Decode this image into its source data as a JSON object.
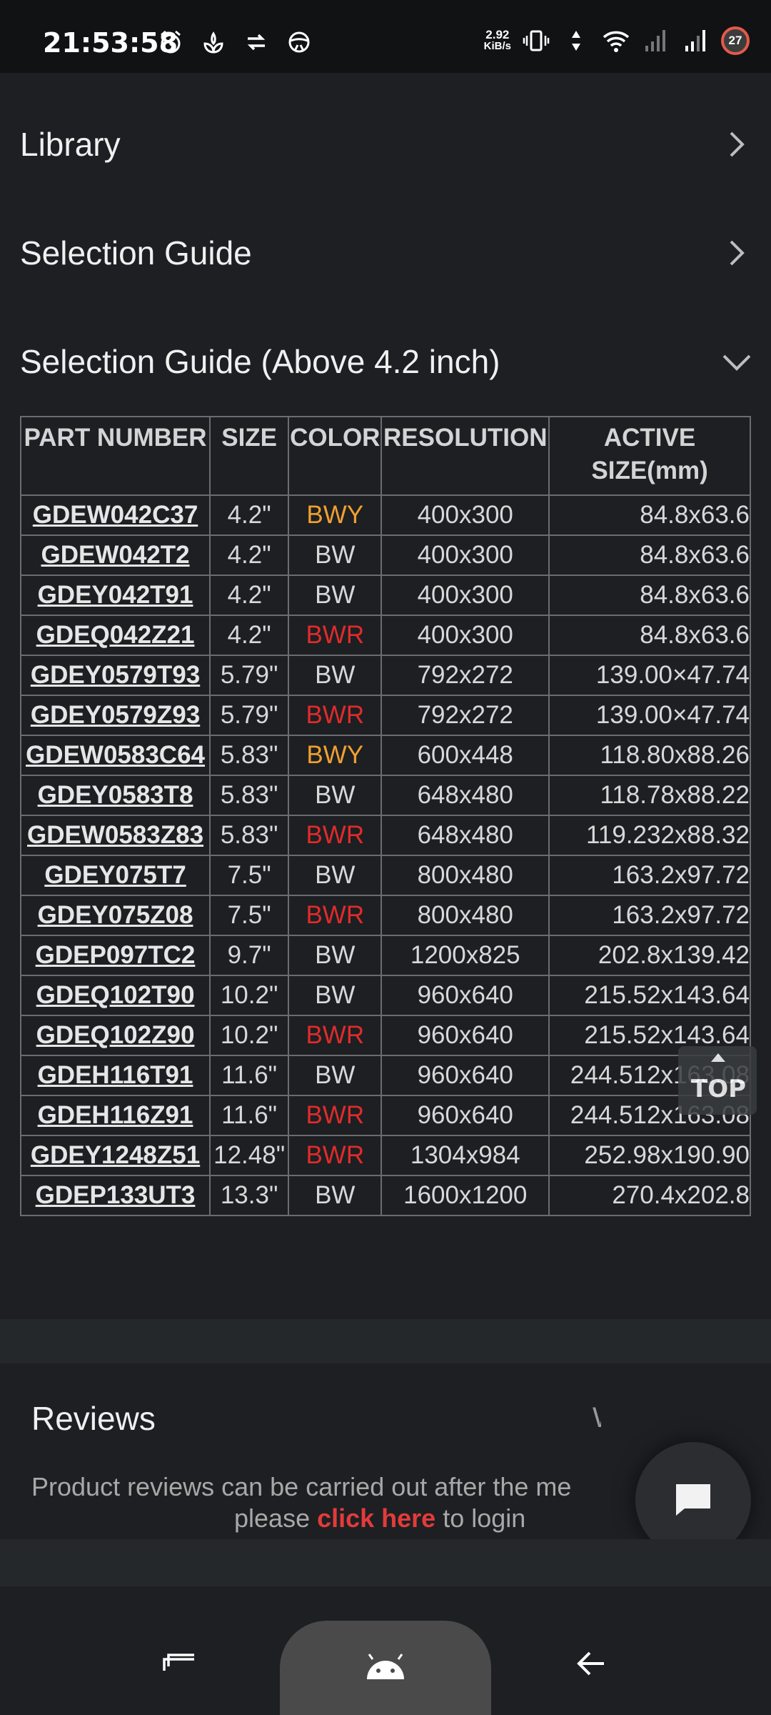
{
  "status": {
    "time": "21:53:58",
    "speed_value": "2.92",
    "speed_unit": "KiB/s",
    "battery": "27"
  },
  "menu": {
    "library": "Library",
    "selection_guide": "Selection Guide",
    "selection_guide_above": "Selection Guide (Above 4.2 inch)"
  },
  "table": {
    "headers": {
      "part": "PART NUMBER",
      "size": "SIZE",
      "color": "COLOR",
      "resolution": "RESOLUTION",
      "active_1": "ACTIVE",
      "active_2": "SIZE(mm)"
    },
    "rows": [
      {
        "part": "GDEW042C37",
        "size": "4.2\"",
        "color": "BWY",
        "resolution": "400x300",
        "active": "84.8x63.6"
      },
      {
        "part": "GDEW042T2",
        "size": "4.2\"",
        "color": "BW",
        "resolution": "400x300",
        "active": "84.8x63.6"
      },
      {
        "part": "GDEY042T91",
        "size": "4.2\"",
        "color": "BW",
        "resolution": "400x300",
        "active": "84.8x63.6"
      },
      {
        "part": "GDEQ042Z21",
        "size": "4.2\"",
        "color": "BWR",
        "resolution": "400x300",
        "active": "84.8x63.6"
      },
      {
        "part": "GDEY0579T93",
        "size": "5.79\"",
        "color": "BW",
        "resolution": "792x272",
        "active": "139.00×47.74"
      },
      {
        "part": "GDEY0579Z93",
        "size": "5.79\"",
        "color": "BWR",
        "resolution": "792x272",
        "active": "139.00×47.74"
      },
      {
        "part": "GDEW0583C64",
        "size": "5.83\"",
        "color": "BWY",
        "resolution": "600x448",
        "active": "118.80x88.26"
      },
      {
        "part": "GDEY0583T8",
        "size": "5.83\"",
        "color": "BW",
        "resolution": "648x480",
        "active": "118.78x88.22"
      },
      {
        "part": "GDEW0583Z83",
        "size": "5.83\"",
        "color": "BWR",
        "resolution": "648x480",
        "active": "119.232x88.32"
      },
      {
        "part": "GDEY075T7",
        "size": "7.5\"",
        "color": "BW",
        "resolution": "800x480",
        "active": "163.2x97.72"
      },
      {
        "part": "GDEY075Z08",
        "size": "7.5\"",
        "color": "BWR",
        "resolution": "800x480",
        "active": "163.2x97.72"
      },
      {
        "part": "GDEP097TC2",
        "size": "9.7\"",
        "color": "BW",
        "resolution": "1200x825",
        "active": "202.8x139.42"
      },
      {
        "part": "GDEQ102T90",
        "size": "10.2\"",
        "color": "BW",
        "resolution": "960x640",
        "active": "215.52x143.64"
      },
      {
        "part": "GDEQ102Z90",
        "size": "10.2\"",
        "color": "BWR",
        "resolution": "960x640",
        "active": "215.52x143.64"
      },
      {
        "part": "GDEH116T91",
        "size": "11.6\"",
        "color": "BW",
        "resolution": "960x640",
        "active": "244.512x163.08"
      },
      {
        "part": "GDEH116Z91",
        "size": "11.6\"",
        "color": "BWR",
        "resolution": "960x640",
        "active": "244.512x163.08"
      },
      {
        "part": "GDEY1248Z51",
        "size": "12.48\"",
        "color": "BWR",
        "resolution": "1304x984",
        "active": "252.98x190.90"
      },
      {
        "part": "GDEP133UT3",
        "size": "13.3\"",
        "color": "BW",
        "resolution": "1600x1200",
        "active": "270.4x202.8"
      }
    ]
  },
  "top_button": "TOP",
  "reviews": {
    "title": "Reviews",
    "partial": "W",
    "line1": "Product reviews can be carried out after the me",
    "line2_pre": "please ",
    "line2_link": "click here",
    "line2_post": " to login"
  },
  "colors": {
    "BWY": "#f0a030",
    "BWR": "#e12b2b",
    "BW": "#d8d8d8"
  }
}
